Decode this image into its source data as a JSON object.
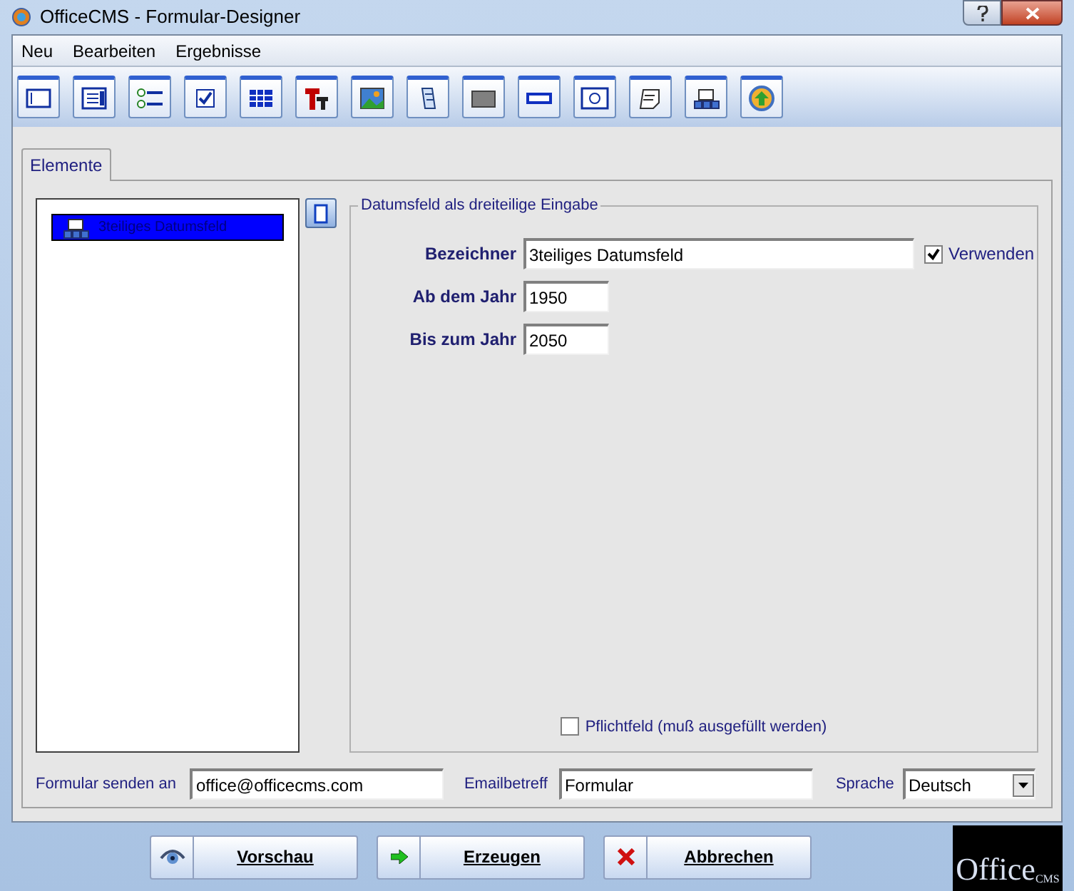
{
  "window": {
    "title": "OfficeCMS - Formular-Designer"
  },
  "menu": [
    "Neu",
    "Bearbeiten",
    "Ergebnisse"
  ],
  "tabs": [
    {
      "label": "Elemente",
      "selected": true
    }
  ],
  "elements": [
    {
      "label": "3teiliges Datumsfeld",
      "selected": true
    }
  ],
  "group": {
    "title": "Datumsfeld als dreiteilige Eingabe",
    "fields": [
      {
        "label": "Bezeichner",
        "value": "3teiliges Datumsfeld",
        "kind": "wide"
      },
      {
        "label": "Ab dem Jahr",
        "value": "1950",
        "kind": "short"
      },
      {
        "label": "Bis zum Jahr",
        "value": "2050",
        "kind": "short"
      }
    ],
    "use": {
      "label": "Verwenden",
      "checked": true
    },
    "required": {
      "label": "Pflichtfeld (muß ausgefüllt werden)",
      "checked": false
    }
  },
  "bottom": {
    "send_label": "Formular senden an",
    "send_value": "office@officecms.com",
    "subject_label": "Emailbetreff",
    "subject_value": "Formular",
    "language_label": "Sprache",
    "language_value": "Deutsch"
  },
  "buttons": [
    {
      "label": "Vorschau",
      "kind": "preview"
    },
    {
      "label": "Erzeugen",
      "kind": "create"
    },
    {
      "label": "Abbrechen",
      "kind": "cancel"
    }
  ],
  "logo": {
    "text": "Office",
    "sub": "CMS"
  }
}
